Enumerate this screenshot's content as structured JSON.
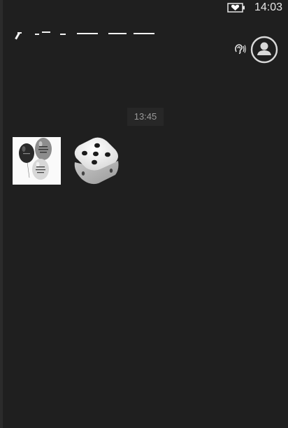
{
  "status_bar": {
    "time": "14:03",
    "battery_icon": "battery-heart-icon"
  },
  "header": {
    "title_icon": "redacted-title",
    "ear_icon": "ear-icon",
    "avatar_icon": "person-avatar-icon"
  },
  "conversation": {
    "timestamp": "13:45",
    "messages": [
      {
        "type": "image",
        "content": "balloons-sticker"
      },
      {
        "type": "dice",
        "value": 5
      }
    ]
  }
}
